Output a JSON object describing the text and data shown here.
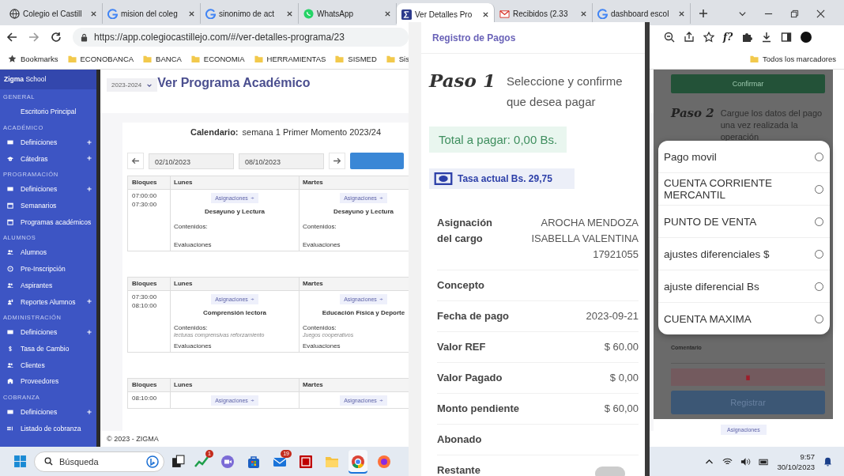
{
  "browser": {
    "tabs": [
      {
        "title": "Colegio el Castill",
        "kind": "globe",
        "selected": false
      },
      {
        "title": "mision del coleg",
        "kind": "google",
        "selected": false
      },
      {
        "title": "sinonimo de act",
        "kind": "google",
        "selected": false
      },
      {
        "title": "WhatsApp",
        "kind": "whatsapp",
        "selected": false
      },
      {
        "title": "Ver Detalles Pro",
        "kind": "sigma",
        "selected": true
      },
      {
        "title": "Recibidos (2.33",
        "kind": "gmail",
        "selected": false
      },
      {
        "title": "dashboard escol",
        "kind": "google",
        "selected": false
      }
    ],
    "url": "https://app.colegiocastillejo.com/#/ver-detalles-programa/23",
    "extension_label": "f?",
    "bookmarks": [
      {
        "label": "Bookmarks",
        "kind": "star"
      },
      {
        "label": "ECONOBANCA",
        "kind": "folder"
      },
      {
        "label": "BANCA",
        "kind": "folder"
      },
      {
        "label": "ECONOMIA",
        "kind": "folder"
      },
      {
        "label": "HERRAMIENTAS",
        "kind": "folder"
      },
      {
        "label": "SISMED",
        "kind": "folder"
      },
      {
        "label": "Sis",
        "kind": "folder"
      }
    ],
    "all_bookmarks": "Todos los marcadores"
  },
  "sidebar": {
    "brand": "**Zigma** School",
    "sections": [
      {
        "title": "GENERAL",
        "items": [
          {
            "label": "Escritorio Principal",
            "kind": "none",
            "expandable": false
          }
        ]
      },
      {
        "title": "ACADÉMICO",
        "items": [
          {
            "label": "Definiciones",
            "kind": "card",
            "expandable": true
          },
          {
            "label": "Cátedras",
            "kind": "cap",
            "expandable": true
          }
        ]
      },
      {
        "title": "PROGRAMACIÓN",
        "items": [
          {
            "label": "Definiciones",
            "kind": "card",
            "expandable": true
          },
          {
            "label": "Semanarios",
            "kind": "calendar",
            "expandable": false
          },
          {
            "label": "Programas académicos",
            "kind": "calendar",
            "expandable": false
          }
        ]
      },
      {
        "title": "ALUMNOS",
        "items": [
          {
            "label": "Alumnos",
            "kind": "people",
            "expandable": false
          },
          {
            "label": "Pre-Inscripción",
            "kind": "circle",
            "expandable": false
          },
          {
            "label": "Aspirantes",
            "kind": "people",
            "expandable": false
          },
          {
            "label": "Reportes Alumnos",
            "kind": "report",
            "expandable": true
          }
        ]
      },
      {
        "title": "ADMINISTRACIÓN",
        "items": [
          {
            "label": "Definiciones",
            "kind": "card",
            "expandable": true
          },
          {
            "label": "Tasa de Cambio",
            "kind": "dollar",
            "expandable": false
          },
          {
            "label": "Clientes",
            "kind": "people",
            "expandable": false
          },
          {
            "label": "Proveedores",
            "kind": "building",
            "expandable": false
          }
        ]
      },
      {
        "title": "COBRANZA",
        "items": [
          {
            "label": "Definiciones",
            "kind": "card",
            "expandable": true
          },
          {
            "label": "Listado de cobranza",
            "kind": "list",
            "expandable": false
          }
        ]
      }
    ]
  },
  "main": {
    "year": "2023-2024",
    "title": "Ver Programa Académico",
    "calendar_label": "Calendario:",
    "calendar_value": "semana 1 Primer Momento 2023/24",
    "date_from": "02/10/2023",
    "date_to": "08/10/2023",
    "blocks": [
      {
        "headers": [
          "Bloques",
          "Lunes",
          "Martes"
        ],
        "times": [
          "07:00:00",
          "07:30:00"
        ],
        "cells": [
          {
            "button": "Asignaciones",
            "subject": "Desayuno y Lectura",
            "contents_label": "Contenidos:",
            "evaluations": "Evaluaciones"
          },
          {
            "button": "Asignaciones",
            "subject": "Desayuno y Lectura",
            "contents_label": "Contenidos:",
            "evaluations": "Evaluaciones"
          }
        ]
      },
      {
        "headers": [
          "Bloques",
          "Lunes",
          "Martes"
        ],
        "times": [
          "07:30:00",
          "08:10:00"
        ],
        "cells": [
          {
            "button": "Asignaciones",
            "subject": "Comprensión lectora",
            "contents_label": "Contenidos:",
            "contents": "lecturas comprensivas reforzamiento",
            "evaluations": "Evaluaciones"
          },
          {
            "button": "Asignaciones",
            "subject": "Educación Física y Deporte",
            "contents_label": "Contenidos:",
            "contents": "Juegos cooperativos",
            "evaluations": "Evaluaciones"
          }
        ]
      },
      {
        "headers": [
          "Bloques",
          "Lunes",
          "Martes"
        ],
        "times": [
          "08:10:00"
        ],
        "cells": [
          {
            "button": "Asignaciones"
          },
          {
            "button": "Asignaciones"
          }
        ]
      }
    ],
    "footer": "© 2023 - ZIGMA",
    "peek_button": "Asignaciones"
  },
  "payment": {
    "header": "Registro de Pagos",
    "step": "Paso 1",
    "instruction": "Seleccione y confirme que desea pagar",
    "total": "Total a pagar: 0,00 Bs.",
    "rate": "Tasa actual Bs. 29,75",
    "rows": [
      {
        "label": "Asignación del cargo",
        "value": "AROCHA MENDOZA ISABELLA VALENTINA 17921055"
      },
      {
        "label": "Concepto"
      },
      {
        "label": "Fecha de pago",
        "value": "2023-09-21"
      },
      {
        "label": "Valor REF",
        "value": "$ 60.00"
      },
      {
        "label": "Valor Pagado",
        "value": "$ 0,00"
      },
      {
        "label": "Monto pendiente",
        "value": "$ 60,00"
      },
      {
        "label": "Abonado"
      },
      {
        "label": "Restante"
      }
    ],
    "toggle": {
      "on": false
    }
  },
  "mobile": {
    "confirm": "Confirmar",
    "step": "Paso 2",
    "instruction": "Cargue los datos del pago una vez realizada la operación",
    "options": [
      {
        "label": "Pago movil",
        "selected": false
      },
      {
        "label": "CUENTA CORRIENTE MERCANTIL",
        "selected": false
      },
      {
        "label": "PUNTO DE VENTA",
        "selected": false
      },
      {
        "label": "ajustes diferenciales $",
        "selected": false
      },
      {
        "label": "ajuste diferencial Bs",
        "selected": false
      },
      {
        "label": "CUENTA MAXIMA",
        "selected": false
      }
    ],
    "comment_label": "Comentario",
    "submit": "Registrar"
  },
  "taskbar": {
    "search": "Búsqueda",
    "apps": [
      {
        "kind": "stocks",
        "badge": "1",
        "selected": false
      },
      {
        "kind": "chat",
        "selected": false
      },
      {
        "kind": "store",
        "selected": false
      },
      {
        "kind": "mail",
        "badge": "19",
        "selected": false
      },
      {
        "kind": "ftp",
        "selected": false
      },
      {
        "kind": "folder",
        "selected": false
      },
      {
        "kind": "chrome",
        "selected": true
      },
      {
        "kind": "firefox",
        "selected": false
      }
    ],
    "time": "9:57",
    "date": "30/10/2023"
  }
}
